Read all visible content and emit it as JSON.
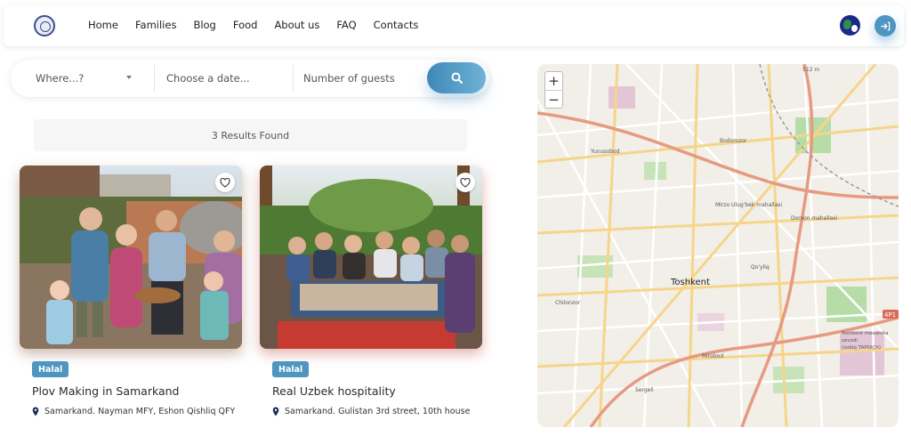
{
  "header": {
    "nav": [
      "Home",
      "Families",
      "Blog",
      "Food",
      "About us",
      "FAQ",
      "Contacts"
    ],
    "icons": {
      "logo": "logo-icon",
      "language": "globe-icon",
      "login": "sign-in-icon"
    },
    "accent_color": "#4e95c1"
  },
  "search": {
    "where_placeholder": "Where...?",
    "date_placeholder": "Choose a date...",
    "guests_placeholder": "Number of guests",
    "button_icon": "search-icon"
  },
  "results": {
    "text": "3 Results Found"
  },
  "cards": [
    {
      "badge": "Halal",
      "title": "Plov Making in Samarkand",
      "address": "Samarkand. Nayman MFY, Eshon Qishliq QFY"
    },
    {
      "badge": "Halal",
      "title": "Real Uzbek hospitality",
      "address": "Samarkand. Gulistan 3rd street, 10th house"
    }
  ],
  "map": {
    "zoom_in": "+",
    "zoom_out": "−",
    "city_label": "Toshkent",
    "district_labels": [
      "Mirzo Ulug'bek mahallasi",
      "Yunusobod",
      "Bodomzor",
      "Qo'yliq",
      "Chilonzor",
      "Dorxon mahallasi",
      "Toshkent mexanika zavodi (sobiq TAPOiCh)",
      "Sergeli",
      "Mirobod"
    ],
    "road_label": "4P1",
    "distance_label": "512 m"
  }
}
